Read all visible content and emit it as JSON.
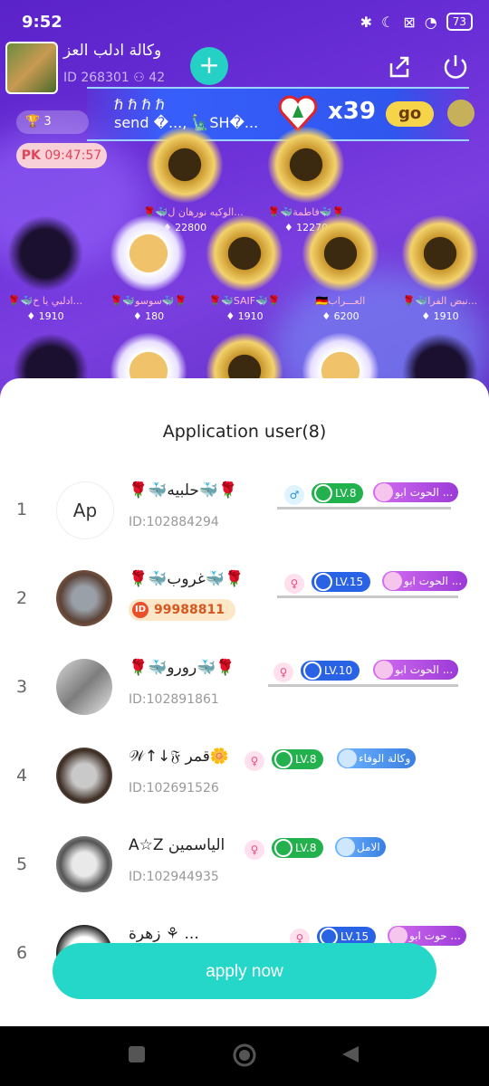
{
  "status": {
    "time": "9:52",
    "battery": "73"
  },
  "room": {
    "name": "وكالة ادلب العز",
    "id_text": "ID 268301",
    "online": "42",
    "pk_timer": "09:47:57",
    "rank_chip": "3"
  },
  "banner": {
    "text_line1": "ℏ ℏ ℏ ℏ",
    "text_line2": "send �..., 🗽SH�...",
    "multiplier": "x39",
    "go_label": "go"
  },
  "seats": [
    {
      "name": "🌹🐳الوكيه نورهان ل...",
      "gifts": "22800"
    },
    {
      "name": "🌹🐳فاطمة🐳🌹",
      "gifts": "12270"
    },
    {
      "name": "🌹🐳ادلبي يا خ...",
      "gifts": "1910"
    },
    {
      "name": "🌹🐳سوسو🐳🌹",
      "gifts": "180"
    },
    {
      "name": "🌹🐳SAIF🐳🌹",
      "gifts": "1910"
    },
    {
      "name": "🇩🇪العـــراب",
      "gifts": "6200"
    },
    {
      "name": "🌹🐳نبض الفرا...",
      "gifts": "1910"
    }
  ],
  "sheet": {
    "title": "Application user(8)",
    "users": [
      {
        "num": "1",
        "nick": "🌹🐳حلبيه🐳🌹",
        "id": "ID:102884294",
        "gender": "♂",
        "level": "LV.8",
        "family": "الحوت ابو ...",
        "avatar_text": "Ap"
      },
      {
        "num": "2",
        "nick": "🌹🐳غروب🐳🌹",
        "vip_id": "99988811",
        "gender": "♀",
        "level": "LV.15",
        "family": "الحوت ابو ..."
      },
      {
        "num": "3",
        "nick": "🌹🐳رورو🐳🌹",
        "id": "ID:102891861",
        "gender": "♀",
        "level": "LV.10",
        "family": "الحوت ابو ..."
      },
      {
        "num": "4",
        "nick": "𝒲↑↓𝔉 قمر🌼",
        "id": "ID:102691526",
        "gender": "♀",
        "level": "LV.8",
        "family": "وكالة الوفاء"
      },
      {
        "num": "5",
        "nick": "A☆Z الياسمين",
        "id": "ID:102944935",
        "gender": "♀",
        "level": "LV.8",
        "family": "الامل"
      },
      {
        "num": "6",
        "nick": "زهرة ⚘ ...",
        "gender": "♀",
        "level": "LV.15",
        "family": "حوت ابو ..."
      }
    ],
    "apply_label": "apply now"
  }
}
